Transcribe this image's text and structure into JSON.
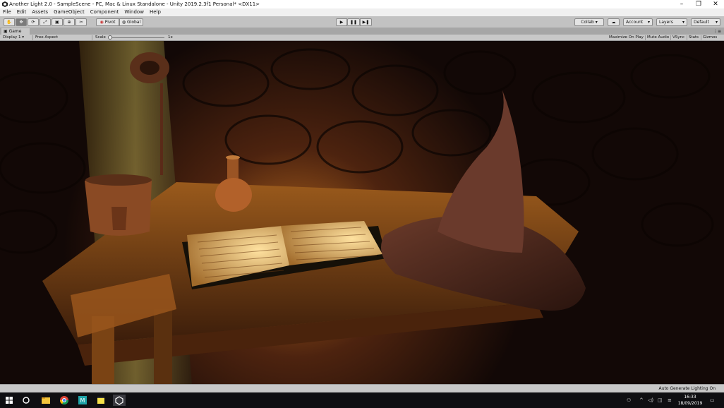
{
  "window": {
    "title": "Another Light 2.0 - SampleScene - PC, Mac & Linux Standalone - Unity 2019.2.3f1 Personal* <DX11>",
    "controls": [
      "–",
      "❐",
      "✕"
    ]
  },
  "menu": [
    "File",
    "Edit",
    "Assets",
    "GameObject",
    "Component",
    "Window",
    "Help"
  ],
  "toolbar": {
    "tools": [
      {
        "name": "hand-tool",
        "icon": "✋"
      },
      {
        "name": "move-tool",
        "icon": "✥"
      },
      {
        "name": "rotate-tool",
        "icon": "⟳"
      },
      {
        "name": "scale-tool",
        "icon": "⤢"
      },
      {
        "name": "rect-tool",
        "icon": "▣"
      },
      {
        "name": "transform-tool",
        "icon": "⊕"
      },
      {
        "name": "custom-tool",
        "icon": "✂"
      }
    ],
    "pivot_label": "Pivot",
    "global_label": "Global",
    "play_icon": "▶",
    "pause_icon": "❚❚",
    "step_icon": "▶❚",
    "collab_label": "Collab ▾",
    "cloud_icon": "☁",
    "account_label": "Account",
    "layers_label": "Layers",
    "layout_label": "Default"
  },
  "game_tab": {
    "label": "Game",
    "menu_icon": "⋮≡"
  },
  "game_bar": {
    "display": "Display 1",
    "aspect": "Free Aspect",
    "scale_label": "Scale",
    "scale_value": "1x",
    "scale_fraction": 0.0,
    "maximize": "Maximize On Play",
    "mute": "Mute Audio",
    "vsync": "VSync",
    "stats": "Stats",
    "gizmos": "Gizmos"
  },
  "status": {
    "text": "Auto Generate Lighting On"
  },
  "taskbar": {
    "apps": [
      "windows-start-icon",
      "search-circle-icon",
      "file-explorer-icon",
      "chrome-icon",
      "unity-hub-icon",
      "sticky-notes-icon",
      "unity-editor-icon"
    ],
    "time": "16:33",
    "date": "18/09/2019"
  },
  "colors": {
    "editor_bg": "#c2c2c2",
    "game_bg": "#1a0e0a",
    "light_warm": "#e8a33c",
    "taskbar": "#0f0f12"
  }
}
